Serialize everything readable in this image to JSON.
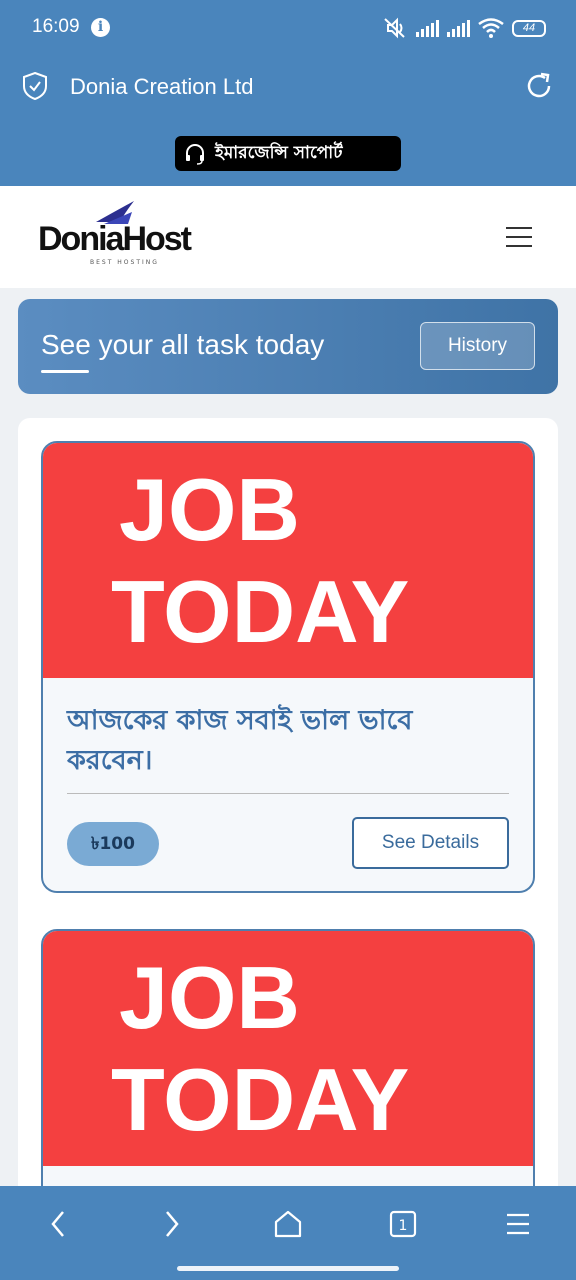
{
  "status_bar": {
    "time": "16:09",
    "battery": "44",
    "icons": [
      "info-icon",
      "mute-icon",
      "signal-icon",
      "signal-icon",
      "wifi-icon",
      "battery-icon"
    ]
  },
  "browser": {
    "site_name": "Donia Creation Ltd",
    "emergency_label": "ইমারজেন্সি সাপোর্ট"
  },
  "site_header": {
    "logo_text": "DoniaHost",
    "logo_tagline": "BEST HOSTING"
  },
  "banner": {
    "title": "See your all task today",
    "history_label": "History"
  },
  "tasks": [
    {
      "image_line1": "JOB",
      "image_line2": "TODAY",
      "title": "আজকের কাজ সবাই ভাল ভাবে করবেন।",
      "price": "৳100",
      "details_label": "See Details"
    },
    {
      "image_line1": "JOB",
      "image_line2": "TODAY"
    }
  ],
  "colors": {
    "brand_blue": "#4a85bc",
    "job_red": "#f44040",
    "title_blue": "#3c6ea5"
  }
}
